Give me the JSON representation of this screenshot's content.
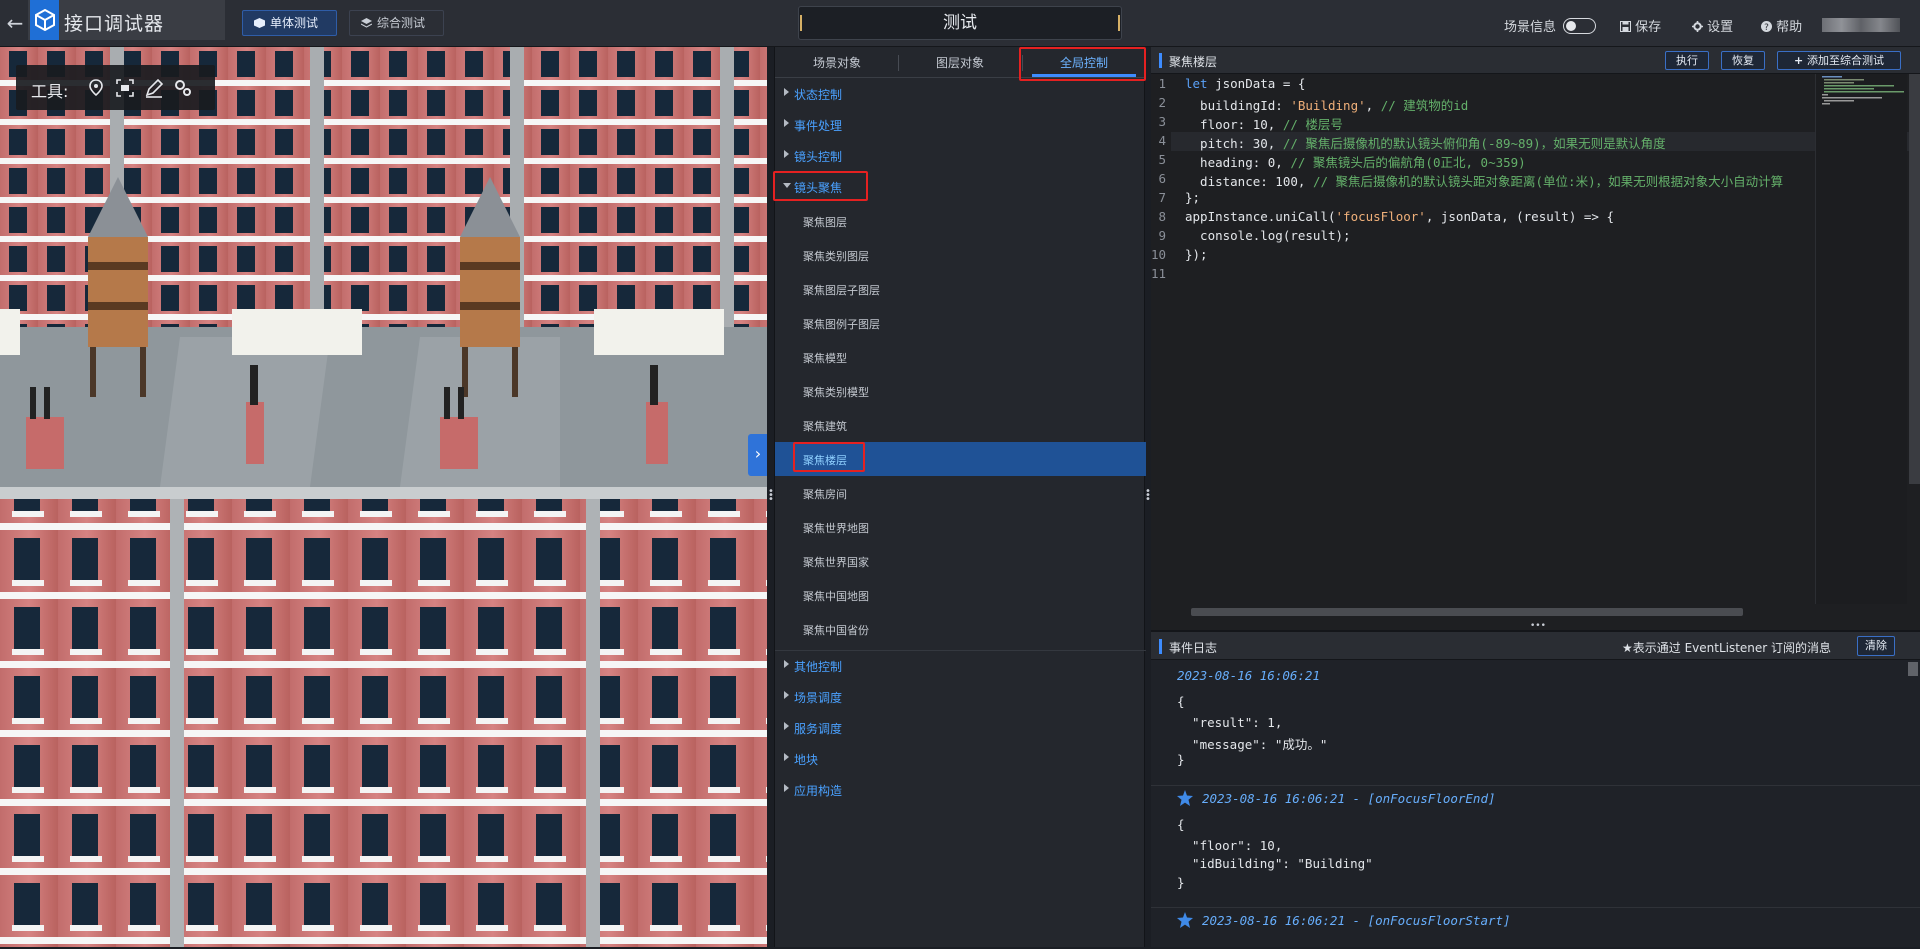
{
  "topbar": {
    "app_title": "接口调试器",
    "mode_tabs": [
      {
        "label": "单体测试",
        "active": true
      },
      {
        "label": "综合测试",
        "active": false
      }
    ],
    "center_title": "测试",
    "scene_info_label": "场景信息",
    "save_label": "保存",
    "settings_label": "设置",
    "help_label": "帮助"
  },
  "scene": {
    "tools_label": "工具:",
    "tools": [
      "location-pin-icon",
      "focus-frame-icon",
      "pen-icon",
      "gears-icon"
    ]
  },
  "tree": {
    "tabs": [
      {
        "label": "场景对象",
        "active": false
      },
      {
        "label": "图层对象",
        "active": false
      },
      {
        "label": "全局控制",
        "active": true
      }
    ],
    "groups_before": [
      "状态控制",
      "事件处理",
      "镜头控制"
    ],
    "open_group": "镜头聚焦",
    "children": [
      "聚焦图层",
      "聚焦类别图层",
      "聚焦图层子图层",
      "聚焦图例子图层",
      "聚焦模型",
      "聚焦类别模型",
      "聚焦建筑",
      "聚焦楼层",
      "聚焦房间",
      "聚焦世界地图",
      "聚焦世界国家",
      "聚焦中国地图",
      "聚焦中国省份"
    ],
    "selected_child": "聚焦楼层",
    "groups_after": [
      "其他控制",
      "场景调度",
      "服务调度",
      "地块",
      "应用构造"
    ]
  },
  "code": {
    "title": "聚焦楼层",
    "run_label": "执行",
    "reset_label": "恢复",
    "add_label": "添加至综合测试",
    "line_numbers": [
      "1",
      "2",
      "3",
      "4",
      "5",
      "6",
      "7",
      "8",
      "9",
      "10",
      "11"
    ],
    "lines": [
      {
        "kw": "let",
        "text": " jsonData = {"
      },
      {
        "text": "  buildingId: ",
        "str": "'Building'",
        "rest": ", ",
        "cmt": "// 建筑物的id"
      },
      {
        "text": "  floor: 10, ",
        "cmt": "// 楼层号"
      },
      {
        "text": "  pitch: 30, ",
        "cmt": "// 聚焦后摄像机的默认镜头俯仰角(-89~89)，如果无则是默认角度"
      },
      {
        "text": "  heading: 0, ",
        "cmt": "// 聚焦镜头后的偏航角(0正北, 0~359)"
      },
      {
        "text": "  distance: 100, ",
        "cmt": "// 聚焦后摄像机的默认镜头距对象距离(单位:米)，如果无则根据对象大小自动计算"
      },
      {
        "text": "};"
      },
      {
        "text": "appInstance.uniCall(",
        "str": "'focusFloor'",
        "rest": ", jsonData, (result) => {"
      },
      {
        "text": "  console.log(result);"
      },
      {
        "text": "});"
      },
      {
        "text": ""
      }
    ]
  },
  "log": {
    "title": "事件日志",
    "hint": "★表示通过 EventListener 订阅的消息",
    "clear_label": "清除",
    "entries": [
      {
        "time": "2023-08-16 16:06:21",
        "starred": false,
        "lines": [
          "{",
          "  \"result\": 1,",
          "  \"message\": \"成功。\"",
          "}"
        ]
      },
      {
        "time": "2023-08-16 16:06:21 - [onFocusFloorEnd]",
        "starred": true,
        "lines": [
          "{",
          "  \"floor\": 10,",
          "  \"idBuilding\": \"Building\"",
          "}"
        ]
      },
      {
        "time": "2023-08-16 16:06:21 - [onFocusFloorStart]",
        "starred": true,
        "lines": []
      }
    ]
  },
  "colors": {
    "accent": "#3d8cff",
    "highlight_red": "#e52121",
    "selected_row": "#1f5296",
    "brick": "#c06f6d"
  }
}
